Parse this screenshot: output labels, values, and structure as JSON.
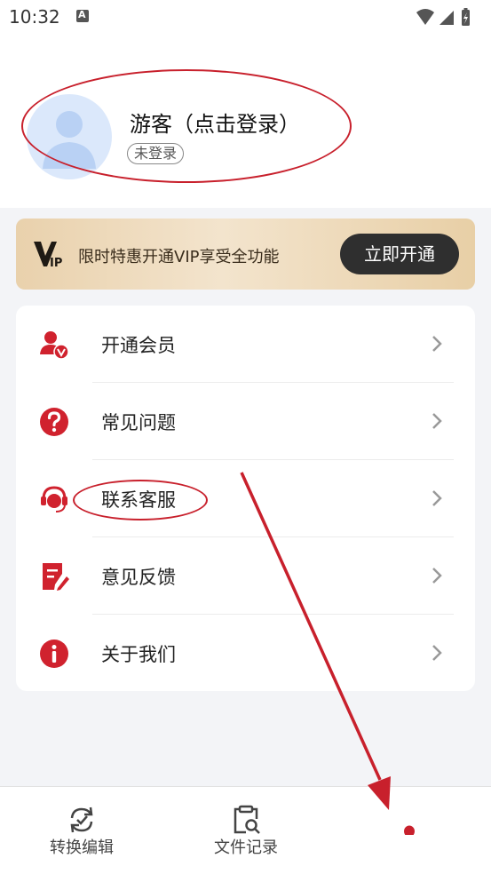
{
  "status_bar": {
    "time": "10:32",
    "icons": [
      "notification-a-icon",
      "wifi-icon",
      "signal-icon",
      "battery-icon"
    ]
  },
  "profile": {
    "name": "游客（点击登录）",
    "badge": "未登录",
    "avatar_icon": "default-user-avatar-icon"
  },
  "vip_banner": {
    "logo_text": "VIP",
    "text": "限时特惠开通VIP享受全功能",
    "button": "立即开通"
  },
  "menu": {
    "items": [
      {
        "label": "开通会员",
        "icon": "member-vip-icon"
      },
      {
        "label": "常见问题",
        "icon": "question-icon"
      },
      {
        "label": "联系客服",
        "icon": "customer-service-headset-icon"
      },
      {
        "label": "意见反馈",
        "icon": "feedback-edit-icon"
      },
      {
        "label": "关于我们",
        "icon": "info-icon"
      }
    ],
    "chevron_icon": "chevron-right-icon"
  },
  "bottom_nav": {
    "items": [
      {
        "label": "转换编辑",
        "icon": "convert-sync-icon"
      },
      {
        "label": "文件记录",
        "icon": "file-search-icon"
      },
      {
        "label": "",
        "icon": "profile-dot-icon"
      }
    ]
  },
  "colors": {
    "accent_red": "#c8202c",
    "icon_red": "#d0222e",
    "vip_gold": "#ecd6b3",
    "vip_button": "#2f2f2f",
    "page_bg": "#f3f4f7"
  }
}
